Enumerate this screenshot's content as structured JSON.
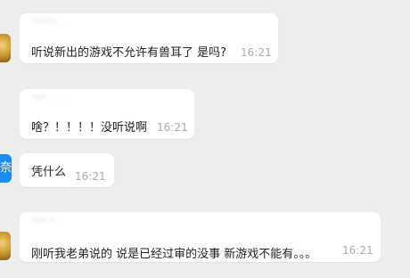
{
  "messages": [
    {
      "sender": "***** ·",
      "text": "听说新出的游戏不允许有兽耳了 是吗?",
      "time": "16:21",
      "avatar": "gold-avatar"
    },
    {
      "sender": "*** · · ·",
      "text": "啥？！！！！没听说啊",
      "time": "16:21",
      "avatar": "none"
    },
    {
      "sender": "",
      "text": "凭什么",
      "time": "16:21",
      "avatar": "blue-avatar",
      "avatar_glyph": "奈"
    },
    {
      "sender": "*** * ·",
      "text": "刚听我老弟说的 说是已经过审的没事 新游戏不能有。。。",
      "time": "16:21",
      "avatar": "gold-avatar"
    }
  ]
}
